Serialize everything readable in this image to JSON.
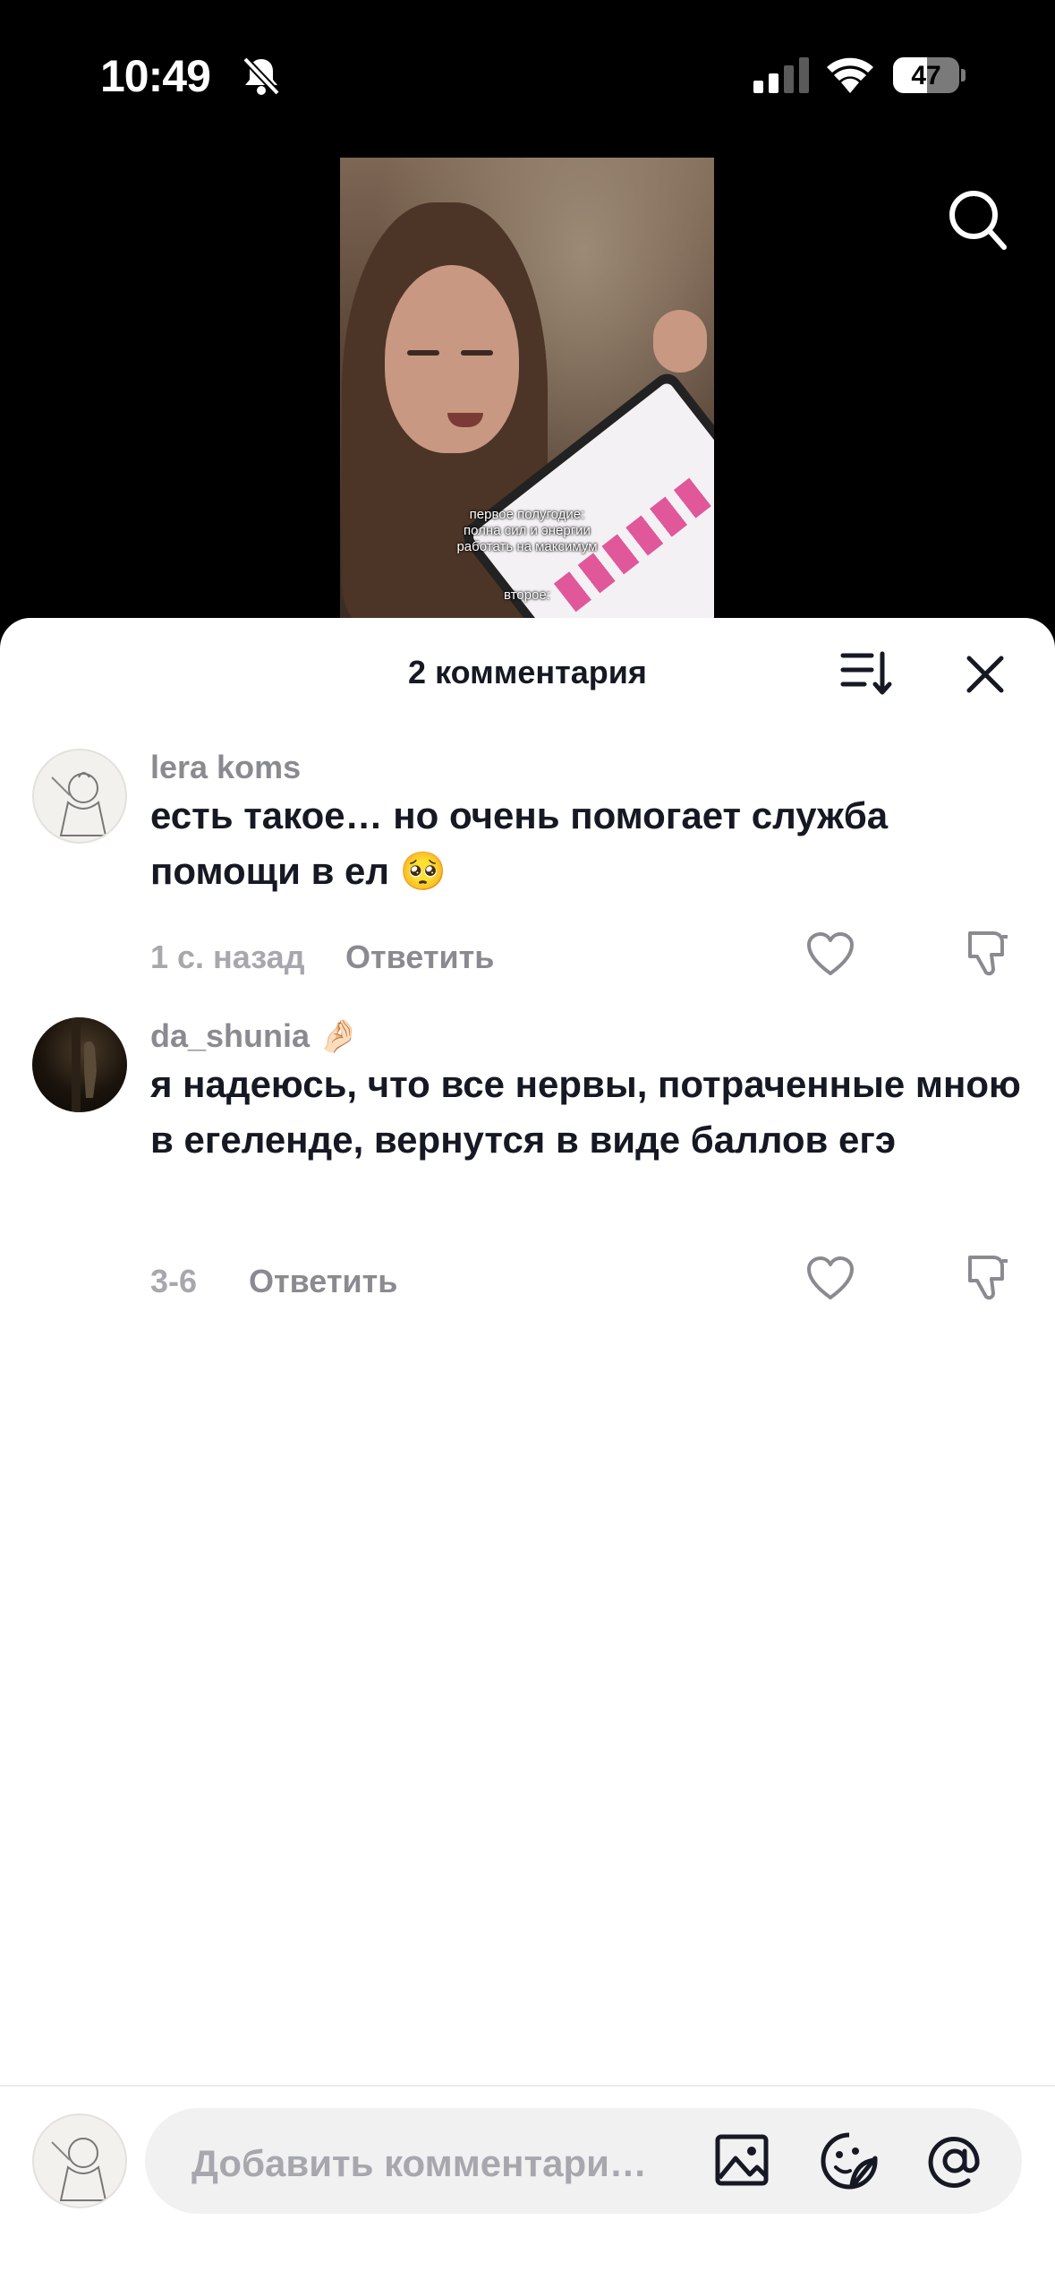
{
  "status": {
    "time": "10:49",
    "battery": "47"
  },
  "video": {
    "caption_line1": "первое полугодие:",
    "caption_line2": "полна сил и энергии",
    "caption_line3": "работать на максимум",
    "caption_line4": "второе:"
  },
  "comments_sheet": {
    "title": "2 комментария",
    "comments": [
      {
        "username": "lera koms",
        "text": "есть такое… но очень помогает служба помощи в ел 🥺",
        "time": "1 с. назад",
        "reply": "Ответить"
      },
      {
        "username": "da_shunia 🤌🏻",
        "text": "я надеюсь, что все нервы, потраченные мною в егеленде, вернутся в виде баллов егэ",
        "time": "3-6",
        "reply": "Ответить"
      }
    ]
  },
  "composer": {
    "placeholder": "Добавить комментари…"
  }
}
